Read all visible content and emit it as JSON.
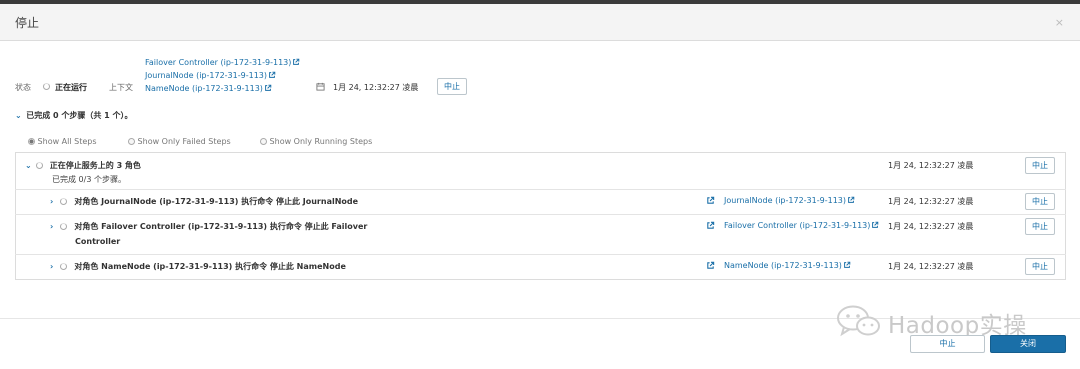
{
  "dialog": {
    "title": "停止",
    "close_glyph": "×"
  },
  "summary": {
    "status_label": "状态",
    "status_value": "正在运行",
    "context_label": "上下文",
    "context_links": [
      "Failover Controller (ip-172-31-9-113)",
      "JournalNode (ip-172-31-9-113)",
      "NameNode (ip-172-31-9-113)"
    ],
    "datetime": "1月 24, 12:32:27 凌晨",
    "abort_label": "中止"
  },
  "progress": {
    "text": "已完成 0 个步骤（共 1 个）。"
  },
  "filters": {
    "options": [
      "Show All Steps",
      "Show Only Failed Steps",
      "Show Only Running Steps"
    ],
    "selected": "Show All Steps"
  },
  "parent_step": {
    "title": "正在停止服务上的 3 角色",
    "sub": "已完成 0/3 个步骤。",
    "time": "1月 24, 12:32:27 凌晨",
    "abort_label": "中止"
  },
  "steps": [
    {
      "title": "对角色 JournalNode (ip-172-31-9-113) 执行命令 停止此 JournalNode",
      "link": "JournalNode (ip-172-31-9-113)",
      "time": "1月 24, 12:32:27 凌晨",
      "abort_label": "中止"
    },
    {
      "title_line1": "对角色 Failover Controller (ip-172-31-9-113) 执行命令 停止此 Failover",
      "title_line2": "Controller",
      "link": "Failover Controller (ip-172-31-9-113)",
      "time": "1月 24, 12:32:27 凌晨",
      "abort_label": "中止"
    },
    {
      "title": "对角色 NameNode (ip-172-31-9-113) 执行命令 停止此 NameNode",
      "link": "NameNode (ip-172-31-9-113)",
      "time": "1月 24, 12:32:27 凌晨",
      "abort_label": "中止"
    }
  ],
  "footer": {
    "abort_label": "中止",
    "close_label": "关闭"
  },
  "watermark": {
    "text": "Hadoop实操"
  },
  "colors": {
    "accent": "#1a6fa8",
    "header_bg": "#f4f4f4"
  }
}
